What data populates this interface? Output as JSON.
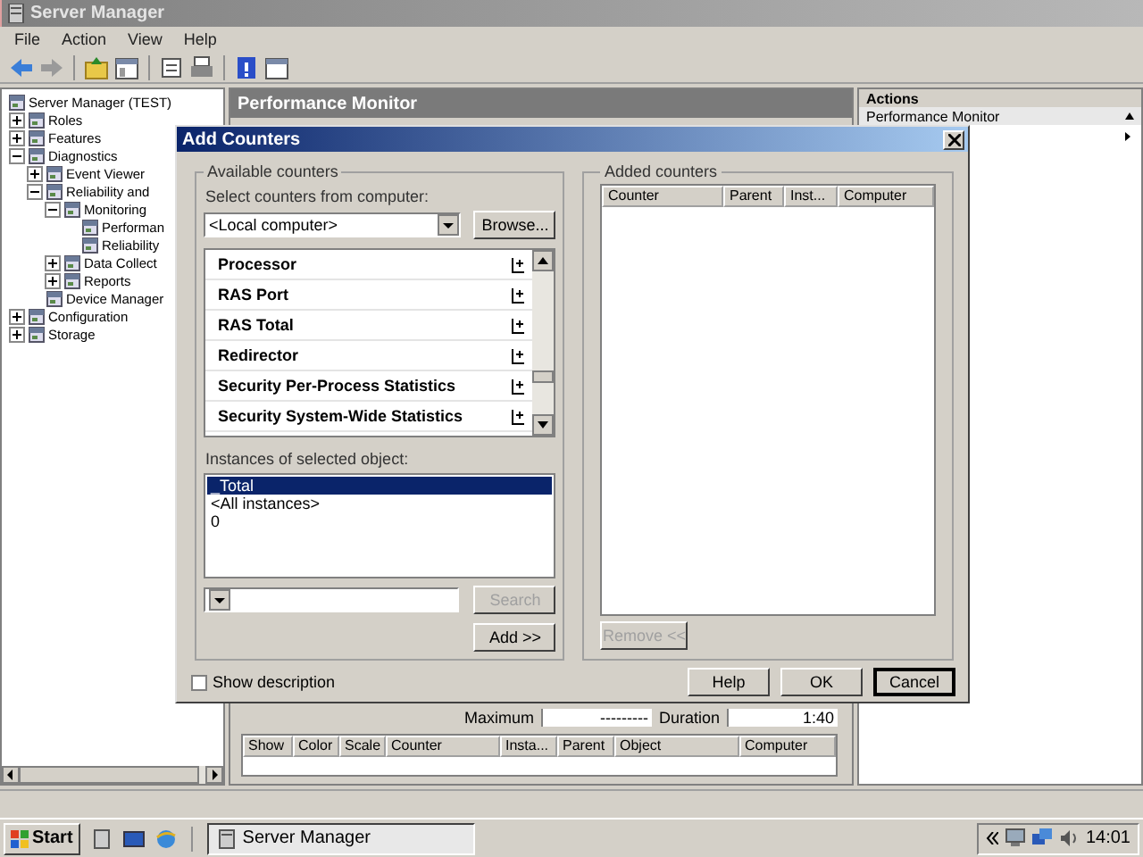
{
  "window": {
    "title": "Server Manager"
  },
  "menu": [
    "File",
    "Action",
    "View",
    "Help"
  ],
  "tree": [
    {
      "label": "Server Manager (TEST)",
      "children": [
        {
          "label": "Roles",
          "expanded": false
        },
        {
          "label": "Features",
          "expanded": false
        },
        {
          "label": "Diagnostics",
          "expanded": true,
          "children": [
            {
              "label": "Event Viewer",
              "expanded": false
            },
            {
              "label": "Reliability and",
              "expanded": true,
              "children": [
                {
                  "label": "Monitoring",
                  "expanded": true,
                  "children": [
                    {
                      "label": "Performan"
                    },
                    {
                      "label": "Reliability"
                    }
                  ]
                },
                {
                  "label": "Data Collect",
                  "expanded": false
                },
                {
                  "label": "Reports",
                  "expanded": false
                }
              ]
            },
            {
              "label": "Device Manager"
            }
          ]
        },
        {
          "label": "Configuration",
          "expanded": false
        },
        {
          "label": "Storage",
          "expanded": false
        }
      ]
    }
  ],
  "center": {
    "title": "Performance Monitor",
    "stats": [
      {
        "label": "Maximum",
        "value": "---------"
      },
      {
        "label": "Duration",
        "value": "1:40"
      }
    ],
    "counter_table": {
      "columns": [
        "Show",
        "Color",
        "Scale",
        "Counter",
        "Insta...",
        "Parent",
        "Object",
        "Computer"
      ]
    }
  },
  "actions": {
    "title": "Actions",
    "items": [
      "Performance Monitor"
    ]
  },
  "dialog": {
    "title": "Add Counters",
    "available": {
      "label": "Available counters",
      "computer_label": "Select counters from computer:",
      "computer": "<Local computer>",
      "browse": "Browse...",
      "objects": [
        "Processor",
        "RAS Port",
        "RAS Total",
        "Redirector",
        "Security Per-Process Statistics",
        "Security System-Wide Statistics"
      ],
      "instances_label": "Instances of selected object:",
      "instances": [
        {
          "label": "_Total",
          "selected": true
        },
        {
          "label": "<All instances>",
          "selected": false
        },
        {
          "label": "0",
          "selected": false
        }
      ],
      "search_button": {
        "label": "Search",
        "disabled": true
      },
      "add_button": {
        "label": "Add >>",
        "disabled": false
      }
    },
    "added": {
      "label": "Added counters",
      "columns": [
        "Counter",
        "Parent",
        "Inst...",
        "Computer"
      ],
      "remove_button": {
        "label": "Remove <<",
        "disabled": true
      }
    },
    "show_description": {
      "label": "Show description",
      "checked": false
    },
    "buttons": [
      {
        "label": "Help",
        "default": false
      },
      {
        "label": "OK",
        "default": false
      },
      {
        "label": "Cancel",
        "default": true
      }
    ]
  },
  "taskbar": {
    "start": "Start",
    "tasks": [
      "Server Manager"
    ],
    "clock": "14:01"
  }
}
